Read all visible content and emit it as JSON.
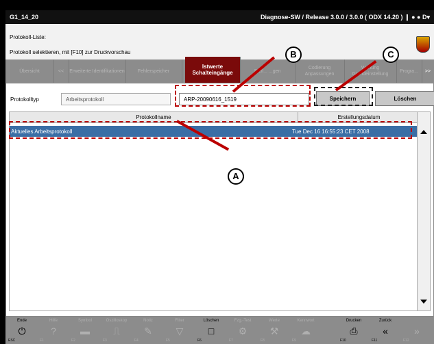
{
  "window": {
    "left_title": "G1_14_20",
    "right_title": "Diagnose-SW / Release 3.0.0 / 3.0.0  ( ODX  14.20 )",
    "status_icons": "❙ ● ● D▾"
  },
  "info": {
    "line1": "Protokoll-Liste:",
    "line2": "Protokoll selektieren, mit [F10] zur Druckvorschau"
  },
  "tabs": [
    {
      "label": "Übersicht"
    },
    {
      "label": "<<"
    },
    {
      "label": "Erweiterte Identifikationen"
    },
    {
      "label": "Fehlerspeicher"
    },
    {
      "label": "Istwerte Schalteingänge"
    },
    {
      "label": "Stell... ...gen"
    },
    {
      "label": "Codierung Anpassungen"
    },
    {
      "label": "Wartung Grundeinstellung"
    },
    {
      "label": "Progra..."
    },
    {
      "label": ">>"
    }
  ],
  "form": {
    "type_label": "Protokolltyp",
    "type_value": "Arbeitsprotokoll",
    "name_value": "ARP-20090616_1519",
    "save_label": "Speichern",
    "delete_label": "Löschen"
  },
  "table": {
    "col1": "Protokollname",
    "col2": "Erstellungsdatum",
    "rows": [
      {
        "name": "Aktuelles Arbeitsprotokoll",
        "date": "Tue Dec 16 16:55:23 CET 2008"
      }
    ]
  },
  "callouts": {
    "a": "A",
    "b": "B",
    "c": "C"
  },
  "fkeys": [
    {
      "name": "Ende",
      "key": "ESC",
      "icon": "power-icon",
      "glyph": "⏻"
    },
    {
      "name": "Hilfe",
      "key": "F1",
      "icon": "help-icon",
      "glyph": "?"
    },
    {
      "name": "Symbol",
      "key": "F2",
      "icon": "keyboard-icon",
      "glyph": "▬"
    },
    {
      "name": "Oszilloskop",
      "key": "F3",
      "icon": "oscilloscope-icon",
      "glyph": "⎍"
    },
    {
      "name": "Notiz",
      "key": "F4",
      "icon": "note-icon",
      "glyph": "✎"
    },
    {
      "name": "Filter",
      "key": "F5",
      "icon": "filter-icon",
      "glyph": "▽"
    },
    {
      "name": "Löschen",
      "key": "F6",
      "icon": "delete-icon",
      "glyph": "□"
    },
    {
      "name": "Fzg.-Test",
      "key": "F7",
      "icon": "vehicle-test-icon",
      "glyph": "⚙"
    },
    {
      "name": "Werte",
      "key": "F8",
      "icon": "values-icon",
      "glyph": "⚒"
    },
    {
      "name": "Kennwort",
      "key": "F9",
      "icon": "password-icon",
      "glyph": "☁"
    },
    {
      "name": "Drucken",
      "key": "F10",
      "icon": "printer-icon",
      "glyph": "⎙"
    },
    {
      "name": "Zurück",
      "key": "F11",
      "icon": "back-icon",
      "glyph": "«"
    },
    {
      "name": "",
      "key": "F12",
      "icon": "forward-icon",
      "glyph": "»"
    }
  ]
}
